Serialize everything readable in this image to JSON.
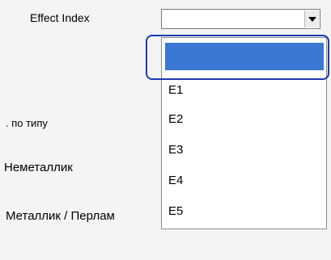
{
  "labels": {
    "effect_index": "Effect Index",
    "by_type": ". по типу",
    "non_metallic": "Неметаллик",
    "metallic": "Металлик / Перлам"
  },
  "combo": {
    "value": "",
    "arrow_icon": "chevron-down-icon"
  },
  "dropdown": {
    "options": [
      "",
      "E1",
      "E2",
      "E3",
      "E4",
      "E5"
    ],
    "selected_index": 0,
    "selection_color": "#3a78d4"
  },
  "annotation": {
    "ring_color": "#1b3db3"
  }
}
